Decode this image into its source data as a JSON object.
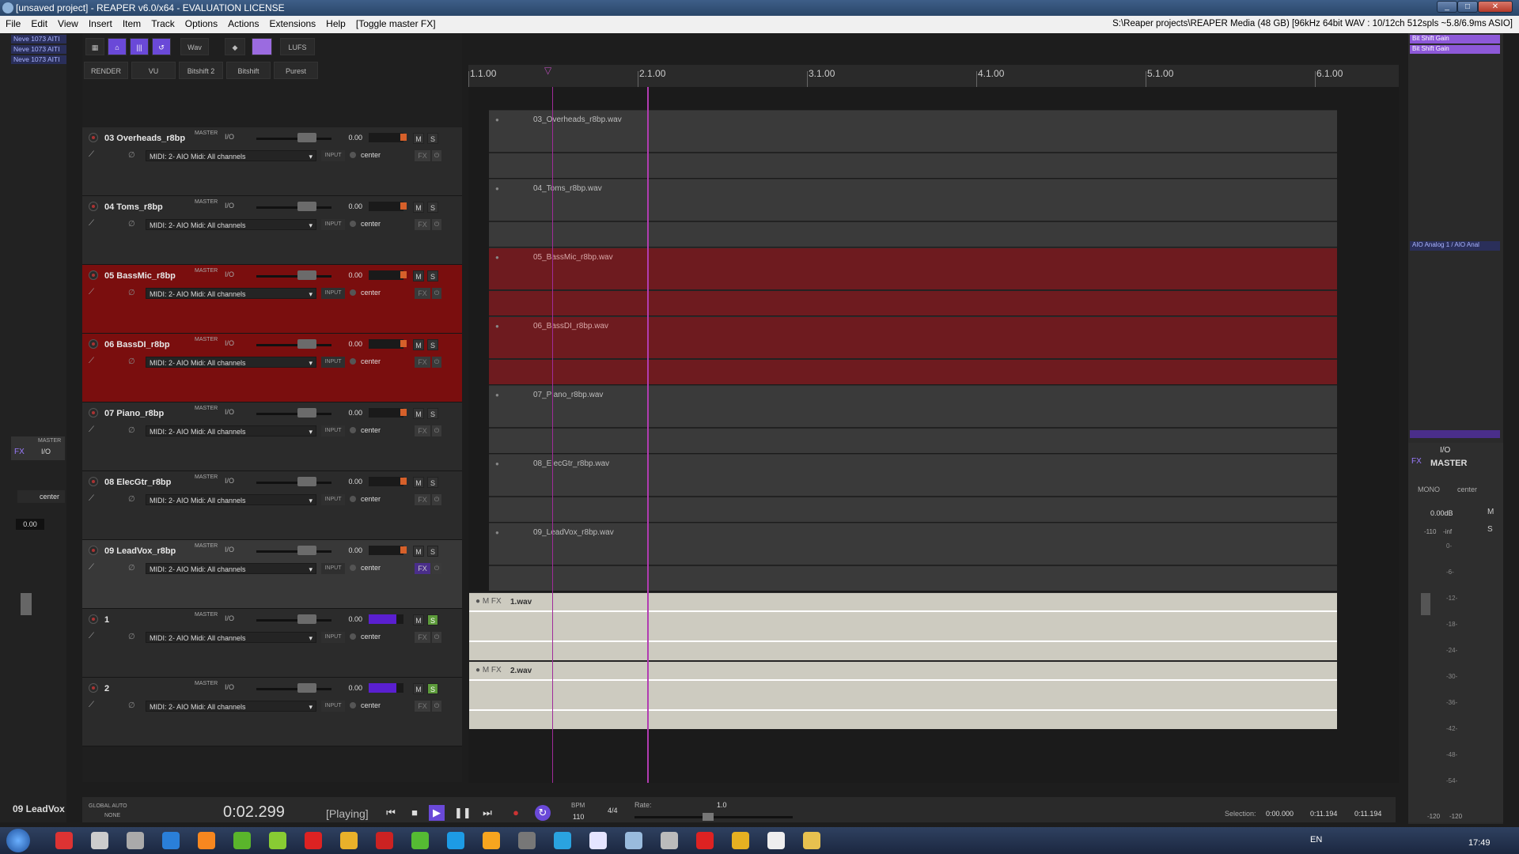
{
  "window": {
    "title": "[unsaved project] - REAPER v6.0/x64 - EVALUATION LICENSE"
  },
  "menubar": {
    "items": [
      "File",
      "Edit",
      "View",
      "Insert",
      "Item",
      "Track",
      "Options",
      "Actions",
      "Extensions",
      "Help",
      "[Toggle master FX]"
    ],
    "status": "S:\\Reaper projects\\REAPER Media (48 GB) [96kHz 64bit WAV : 10/12ch 512spls ~5.8/6.9ms ASIO]"
  },
  "left_fx": [
    "Neve 1073 AITI",
    "Neve 1073 AITI",
    "Neve 1073 AITI"
  ],
  "toolbar": {
    "row1": [
      "Wav",
      "LUFS"
    ],
    "row2": [
      "RENDER",
      "VU",
      "Bitshift 2",
      "Bitshift",
      "Purest"
    ]
  },
  "ruler": [
    "1.1.00",
    "2.1.00",
    "3.1.00",
    "4.1.00",
    "5.1.00",
    "6.1.00"
  ],
  "tracks": [
    {
      "name": "03 Overheads_r8bp",
      "vol": "0.00",
      "midi": "MIDI: 2- AIO Midi: All channels",
      "pan": "center",
      "item": "03_Overheads_r8bp.wav"
    },
    {
      "name": "04 Toms_r8bp",
      "vol": "0.00",
      "midi": "MIDI: 2- AIO Midi: All channels",
      "pan": "center",
      "item": "04_Toms_r8bp.wav"
    },
    {
      "name": "05 BassMic_r8bp",
      "vol": "0.00",
      "midi": "MIDI: 2- AIO Midi: All channels",
      "pan": "center",
      "item": "05_BassMic_r8bp.wav"
    },
    {
      "name": "06 BassDI_r8bp",
      "vol": "0.00",
      "midi": "MIDI: 2- AIO Midi: All channels",
      "pan": "center",
      "item": "06_BassDI_r8bp.wav"
    },
    {
      "name": "07 Piano_r8bp",
      "vol": "0.00",
      "midi": "MIDI: 2- AIO Midi: All channels",
      "pan": "center",
      "item": "07_Piano_r8bp.wav"
    },
    {
      "name": "08 ElecGtr_r8bp",
      "vol": "0.00",
      "midi": "MIDI: 2- AIO Midi: All channels",
      "pan": "center",
      "item": "08_ElecGtr_r8bp.wav"
    },
    {
      "name": "09 LeadVox_r8bp",
      "vol": "0.00",
      "midi": "MIDI: 2- AIO Midi: All channels",
      "pan": "center",
      "item": "09_LeadVox_r8bp.wav"
    },
    {
      "name": "1",
      "vol": "0.00",
      "midi": "MIDI: 2- AIO Midi: All channels",
      "pan": "center",
      "item": "1.wav"
    },
    {
      "name": "2",
      "vol": "0.00",
      "midi": "MIDI: 2- AIO Midi: All channels",
      "pan": "center",
      "item": "2.wav"
    }
  ],
  "labels": {
    "master": "MASTER",
    "io": "I/O",
    "m": "M",
    "s": "S",
    "fx": "FX",
    "input": "INPUT",
    "phase": "∅"
  },
  "left_mixer": {
    "vol": "0.00",
    "pan": "center",
    "track_label": "09 LeadVox"
  },
  "right_mixer": {
    "fx": [
      "Bit Shift Gain",
      "Bit Shift Gain"
    ],
    "route": "AIO Analog 1 / AIO Anal",
    "master_label": "MASTER",
    "mono": "MONO",
    "pan": "center",
    "vol": "0.00dB",
    "peak_l": "-110",
    "peak_r": "-inf",
    "scale": [
      "0-",
      "-6-",
      "-12-",
      "-18-",
      "-24-",
      "-30-",
      "-36-",
      "-42-",
      "-48-",
      "-54-"
    ],
    "bottom_l": "-120",
    "bottom_r": "-120"
  },
  "transport": {
    "automation_label": "GLOBAL AUTO",
    "automation_mode": "NONE",
    "time": "0:02.299",
    "status": "[Playing]",
    "bpm_label": "BPM",
    "bpm": "110",
    "sig": "4/4",
    "rate_label": "Rate:",
    "rate": "1.0",
    "selection_label": "Selection:",
    "sel_start": "0:00.000",
    "sel_end": "0:11.194",
    "sel_len": "0:11.194"
  },
  "taskbar": {
    "lang": "EN",
    "time": "17:49"
  }
}
